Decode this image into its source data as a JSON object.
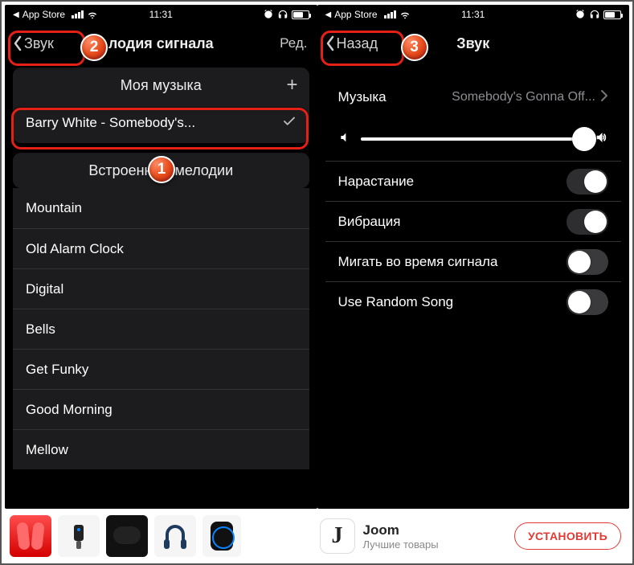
{
  "status": {
    "breadcrumb": "App Store",
    "time": "11:31"
  },
  "left_phone": {
    "nav_back": "Звук",
    "nav_title": "лодия сигнала",
    "nav_edit": "Ред.",
    "section_my_music": "Моя музыка",
    "selected_song": "Barry White -  Somebody's...",
    "section_builtin": "Встроенные мелодии",
    "builtin": [
      "Mountain",
      "Old Alarm Clock",
      "Digital",
      "Bells",
      "Get Funky",
      "Good Morning",
      "Mellow"
    ]
  },
  "right_phone": {
    "nav_back": "Назад",
    "nav_title": "Звук",
    "music_label": "Музыка",
    "music_value": "Somebody's Gonna Off...",
    "rows": [
      {
        "label": "Нарастание",
        "on": true
      },
      {
        "label": "Вибрация",
        "on": true
      },
      {
        "label": "Мигать во время сигнала",
        "on": false
      },
      {
        "label": "Use Random Song",
        "on": false
      }
    ]
  },
  "badges": {
    "b1": "1",
    "b2": "2",
    "b3": "3"
  },
  "ad": {
    "brand": "Joom",
    "tagline": "Лучшие товары",
    "cta": "УСТАНОВИТЬ",
    "logo_glyph": "J"
  }
}
